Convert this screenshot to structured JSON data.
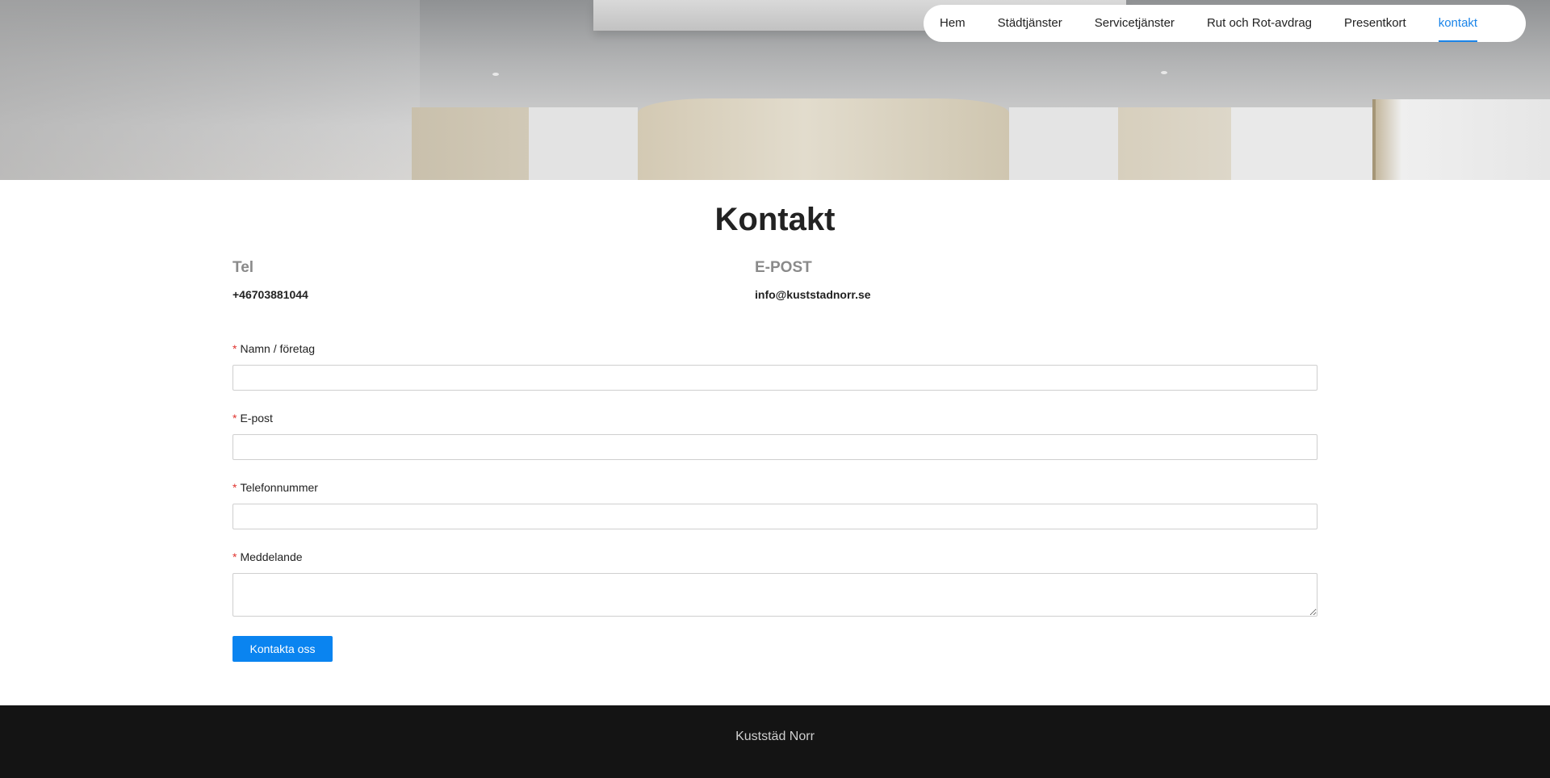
{
  "nav": {
    "items": [
      {
        "label": "Hem",
        "active": false
      },
      {
        "label": "Städtjänster",
        "active": false
      },
      {
        "label": "Servicetjänster",
        "active": false
      },
      {
        "label": "Rut och Rot-avdrag",
        "active": false
      },
      {
        "label": "Presentkort",
        "active": false
      },
      {
        "label": "kontakt",
        "active": true
      }
    ],
    "accent_color": "#1a84e8"
  },
  "page": {
    "title": "Kontakt"
  },
  "contact": {
    "phone_label": "Tel",
    "phone_value": "+46703881044",
    "email_label": "E-POST",
    "email_value": "info@kuststadnorr.se"
  },
  "form": {
    "required_marker": "*",
    "fields": {
      "name": {
        "label": "Namn / företag",
        "value": ""
      },
      "email": {
        "label": "E-post",
        "value": ""
      },
      "phone": {
        "label": "Telefonnummer",
        "value": ""
      },
      "message": {
        "label": "Meddelande",
        "value": ""
      }
    },
    "submit_label": "Kontakta oss",
    "submit_color": "#0a84f0",
    "required_color": "#e0332e"
  },
  "footer": {
    "text": "Kuststäd Norr"
  }
}
